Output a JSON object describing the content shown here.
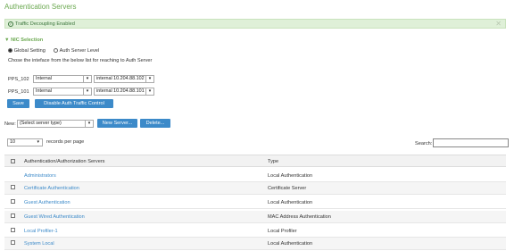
{
  "page": {
    "title": "Authentication Servers",
    "banner": {
      "message": "Traffic Decoupling Enabled",
      "close": "✕"
    },
    "nic_section": {
      "header": "NIC Selection",
      "radio_global": "Global Setting",
      "radio_auth": "Auth Server Level",
      "instruction": "Chose the inteface from the below list for reaching to Auth Server",
      "rows": [
        {
          "node": "PPS_102",
          "iface": "Internal",
          "addr": "internal 10.204.88.102"
        },
        {
          "node": "PPS_101",
          "iface": "Internal",
          "addr": "internal 10.204.88.101"
        }
      ],
      "save": "Save",
      "disable": "Disable Auth Traffic Control"
    },
    "new_row": {
      "label": "New:",
      "select": "(Select server type)",
      "new_server": "New Server...",
      "delete": "Delete..."
    },
    "records": {
      "count": "10",
      "label": "records per page"
    },
    "search": {
      "label": "Search:",
      "value": ""
    },
    "table": {
      "headers": [
        "Authentication/Authorization Servers",
        "Type"
      ],
      "rows": [
        {
          "name": "Administrators",
          "type": "Local Authentication"
        },
        {
          "name": "Certificate Authentication",
          "type": "Certificate Server"
        },
        {
          "name": "Guest Authentication",
          "type": "Local Authentication"
        },
        {
          "name": "Guest Wired Authentication",
          "type": "MAC Address Authentication"
        },
        {
          "name": "Local Profiler-1",
          "type": "Local Profiler"
        },
        {
          "name": "System Local",
          "type": "Local Authentication"
        }
      ]
    }
  },
  "colors": {
    "accent": "#6aa84f",
    "button": "#3c8ac9",
    "banner_bg": "#dff0d8"
  }
}
